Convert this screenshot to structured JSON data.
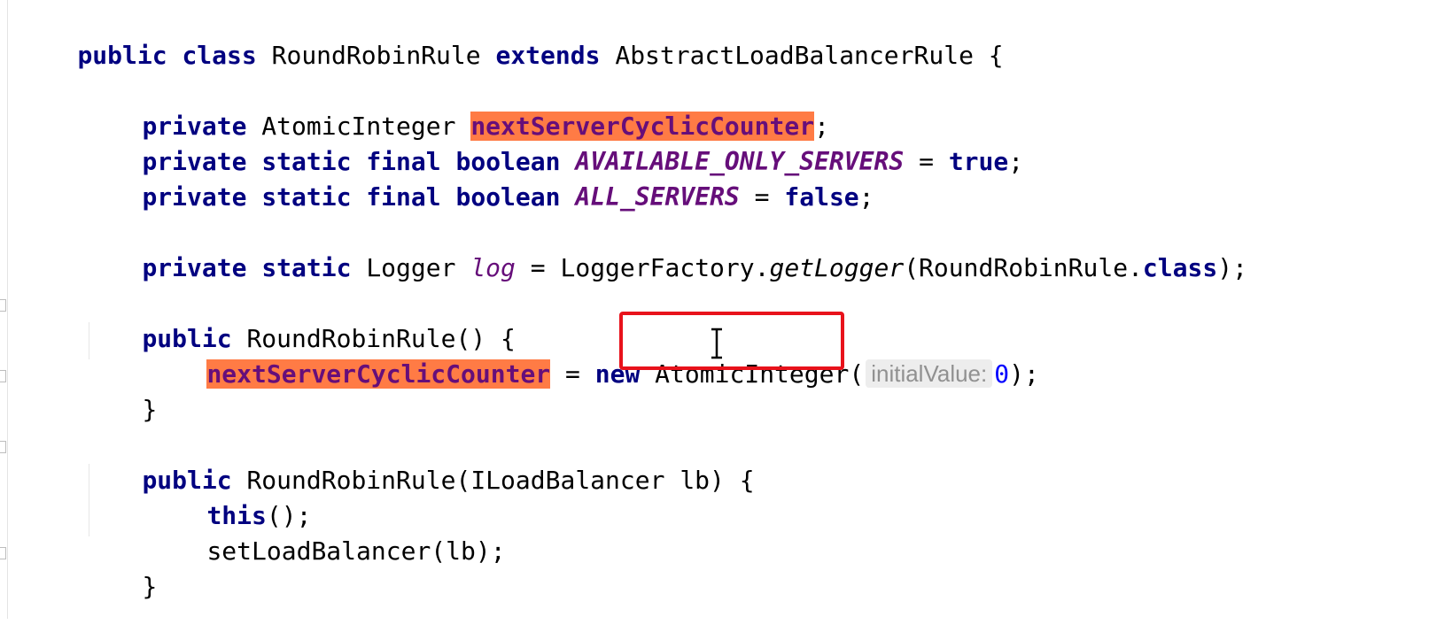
{
  "editor": {
    "theme": {
      "keyword": "#000080",
      "constant": "#660e7a",
      "number": "#0000ff",
      "highlight": "#ff7b45",
      "focus_box": "#e8121b"
    },
    "lines": {
      "l1": {
        "public": "public",
        "class": "class",
        "name": " RoundRobinRule ",
        "extends": "extends",
        "rest": " AbstractLoadBalancerRule {"
      },
      "l2": {
        "private": "private",
        "type": " AtomicInteger ",
        "field": "nextServerCyclicCounter",
        "end": ";"
      },
      "l3": {
        "private": "private",
        "static": "static",
        "final": "final",
        "boolean": "boolean",
        "const": "AVAILABLE_ONLY_SERVERS",
        "eq": " = ",
        "value": "true",
        "end": ";"
      },
      "l4": {
        "private": "private",
        "static": "static",
        "final": "final",
        "boolean": "boolean",
        "const": "ALL_SERVERS",
        "eq": " = ",
        "value": "false",
        "end": ";"
      },
      "l5": {
        "private": "private",
        "static": "static",
        "type": " Logger ",
        "field": "log",
        "eq": " = LoggerFactory.",
        "method": "getLogger",
        "args": "(RoundRobinRule.",
        "class_kw": "class",
        "end": ");"
      },
      "l6": {
        "public": "public",
        "rest": " RoundRobinRule() {"
      },
      "l7": {
        "field": "nextServerCyclicCounter",
        "eq": " = ",
        "new": "new",
        "type": " AtomicInteger(",
        "hint": "initialValue:",
        "num": "0",
        "end": ");"
      },
      "l8": {
        "brace": "}"
      },
      "l9": {
        "public": "public",
        "rest": " RoundRobinRule(ILoadBalancer lb) {"
      },
      "l10": {
        "this": "this",
        "end": "();"
      },
      "l11": {
        "text": "setLoadBalancer(lb);"
      },
      "l12": {
        "brace": "}"
      }
    }
  }
}
